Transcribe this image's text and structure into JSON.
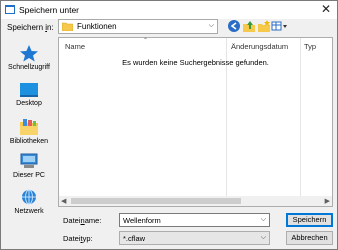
{
  "window": {
    "title": "Speichern unter",
    "close": "✕"
  },
  "savein": {
    "label_pre": "Speichern ",
    "label_key": "i",
    "label_post": "n:",
    "value": "Funktionen"
  },
  "places": [
    {
      "label": "Schnellzugriff",
      "icon": "star-icon"
    },
    {
      "label": "Desktop",
      "icon": "desktop-icon"
    },
    {
      "label": "Bibliotheken",
      "icon": "library-icon"
    },
    {
      "label": "Dieser PC",
      "icon": "computer-icon"
    },
    {
      "label": "Netzwerk",
      "icon": "network-icon"
    }
  ],
  "list": {
    "columns": [
      "Name",
      "Änderungsdatum",
      "Typ"
    ],
    "empty_message": "Es wurden keine Suchergebnisse gefunden."
  },
  "filename": {
    "label_key": "n",
    "label_pre": "Datei",
    "label_post": "ame:",
    "value": "Wellenform"
  },
  "filetype": {
    "label_pre": "Datei",
    "label_key": "t",
    "label_post": "yp:",
    "value": "*.cflaw"
  },
  "buttons": {
    "save": "Speichern",
    "cancel": "Abbrechen"
  },
  "colors": {
    "accent": "#0078d7",
    "folder": "#f6c94b"
  }
}
